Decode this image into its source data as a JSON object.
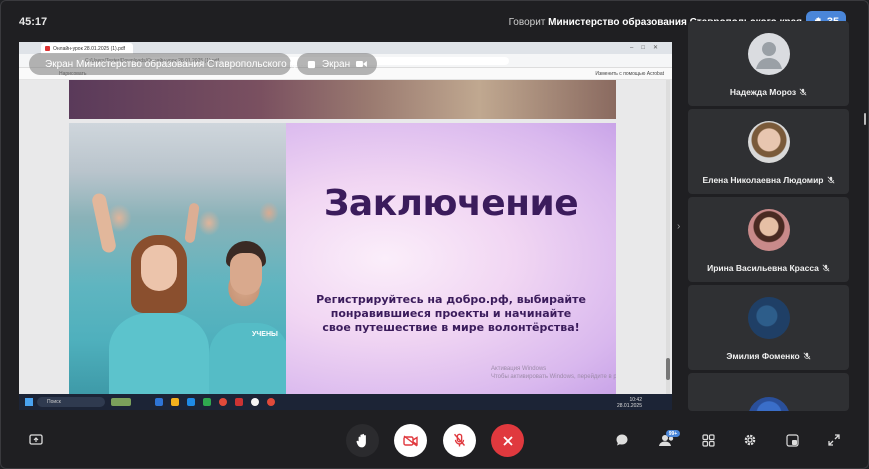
{
  "header": {
    "timer": "45:17",
    "speaking_prefix": "Говорит",
    "speaker": "Министерство образования Ставропольского края",
    "raised_hands": "35"
  },
  "screen_share": {
    "pill_label": "Экран Министерство образования Ставропольского края",
    "pill_screen": "Экран",
    "browser": {
      "tab_title": "Онлайн-урок 28.01.2025 (1).pdf",
      "url": "C:/Users/Tester/Downloads/Онлайн-урок 28.01.2025 (1).pdf",
      "pdf_toolbar_left": "Нарисовать",
      "pdf_toolbar_right": "Изменить с помощью Acrobat"
    },
    "slide": {
      "title": "Заключение",
      "text": "Регистрируйтесь на добро.рф, выбирайте понравившиеся проекты и начинайте свое путешествие в мире волонтёрства!",
      "shirt_text": "УЧЕНЫ",
      "watermark_line1": "Активация Windows",
      "watermark_line2": "Чтобы активировать Windows, перейдите в раздел \"Параметры\"."
    },
    "taskbar": {
      "search_placeholder": "Поиск",
      "time": "10:42",
      "date": "28.01.2025"
    }
  },
  "participants": [
    {
      "name": "Надежда Мороз",
      "avatar": "default-avatar"
    },
    {
      "name": "Елена Николаевна Людомир",
      "avatar": "photo"
    },
    {
      "name": "Ирина Васильевна Красса",
      "avatar": "photo"
    },
    {
      "name": "Эмилия Фоменко",
      "avatar": "photo"
    },
    {
      "name": "",
      "avatar": "photo"
    }
  ],
  "controls": {
    "participants_badge": "99+",
    "colors": {
      "accent": "#4a86d9",
      "end_call": "#e0393e",
      "mic_off_bg": "#ffffff"
    }
  }
}
